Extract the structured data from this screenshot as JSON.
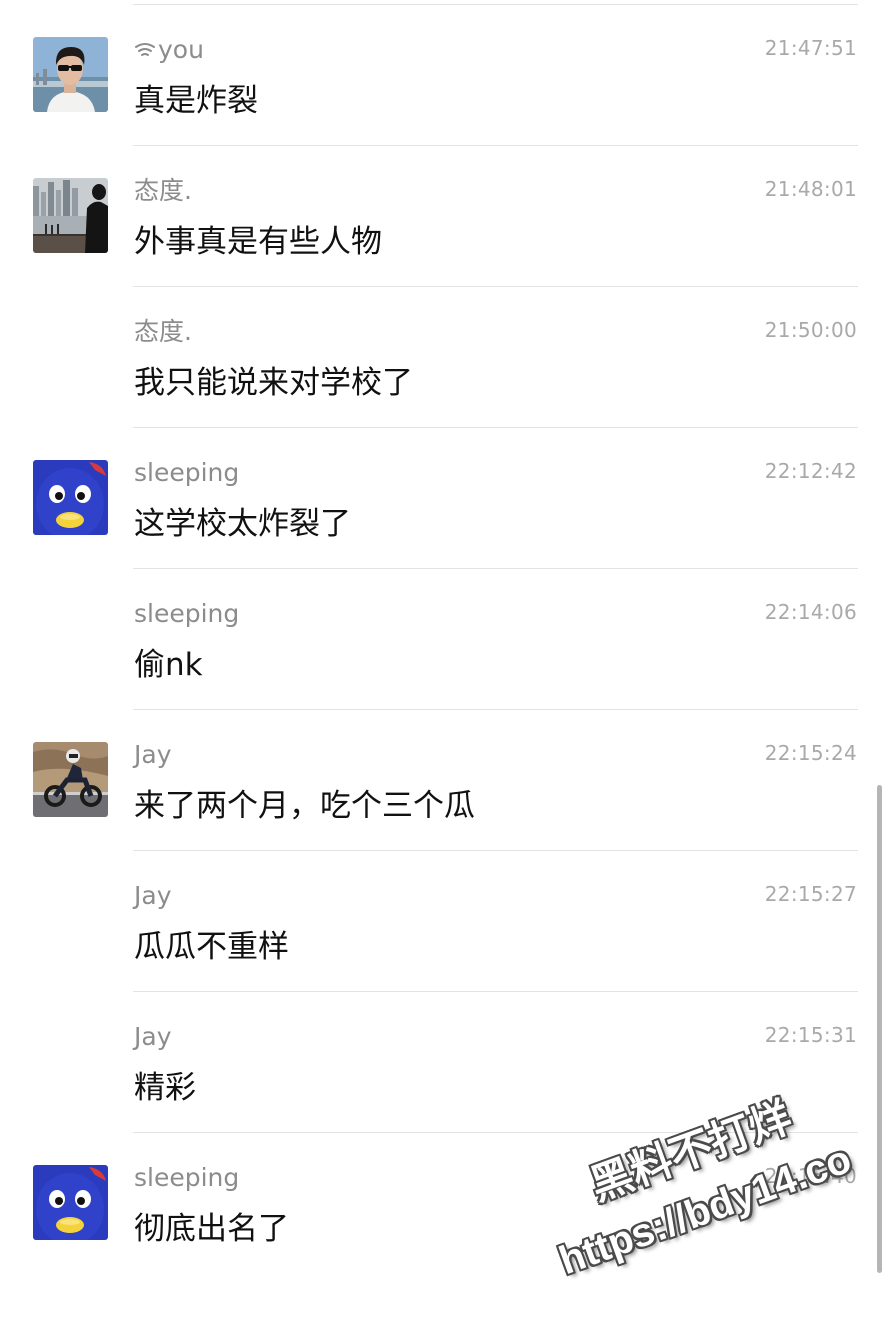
{
  "messages": [
    {
      "sender": "you",
      "show_wifi": true,
      "time": "21:47:51",
      "text": "真是炸裂",
      "avatar": "young-man-sunglasses-avatar"
    },
    {
      "sender": "态度.",
      "time": "21:48:01",
      "text": "外事真是有些人物",
      "avatar": "city-skyline-silhouette-avatar"
    },
    {
      "sender": "态度.",
      "time": "21:50:00",
      "text": "我只能说来对学校了",
      "avatar": null
    },
    {
      "sender": "sleeping",
      "time": "22:12:42",
      "text": "这学校太炸裂了",
      "avatar": "blue-penguin-avatar"
    },
    {
      "sender": "sleeping",
      "time": "22:14:06",
      "text": "偷nk",
      "avatar": null
    },
    {
      "sender": "Jay",
      "time": "22:15:24",
      "text": "来了两个月，吃个三个瓜",
      "avatar": "motorcycle-rider-avatar"
    },
    {
      "sender": "Jay",
      "time": "22:15:27",
      "text": "瓜瓜不重样",
      "avatar": null
    },
    {
      "sender": "Jay",
      "time": "22:15:31",
      "text": "精彩",
      "avatar": null
    },
    {
      "sender": "sleeping",
      "time": "22:15:40",
      "text": "彻底出名了",
      "avatar": "blue-penguin-avatar"
    }
  ],
  "watermark": {
    "line1": "黑料不打烊",
    "line2": "https://bdy14.co"
  },
  "colors": {
    "sender": "#8c8c8c",
    "time": "#a9a9a9",
    "text": "#111111",
    "divider": "#e3e3e3",
    "background": "#ffffff"
  }
}
